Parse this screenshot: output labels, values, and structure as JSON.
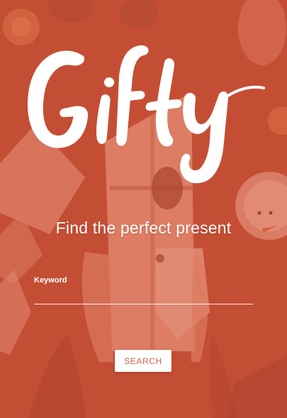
{
  "brand": {
    "logo_text": "Gifty"
  },
  "hero": {
    "tagline": "Find the perfect present"
  },
  "search": {
    "label": "Keyword",
    "value": "",
    "placeholder": "",
    "button_label": "SEARCH"
  },
  "colors": {
    "overlay": "#d6583c",
    "button_text": "#d9604a",
    "text": "#ffffff"
  }
}
